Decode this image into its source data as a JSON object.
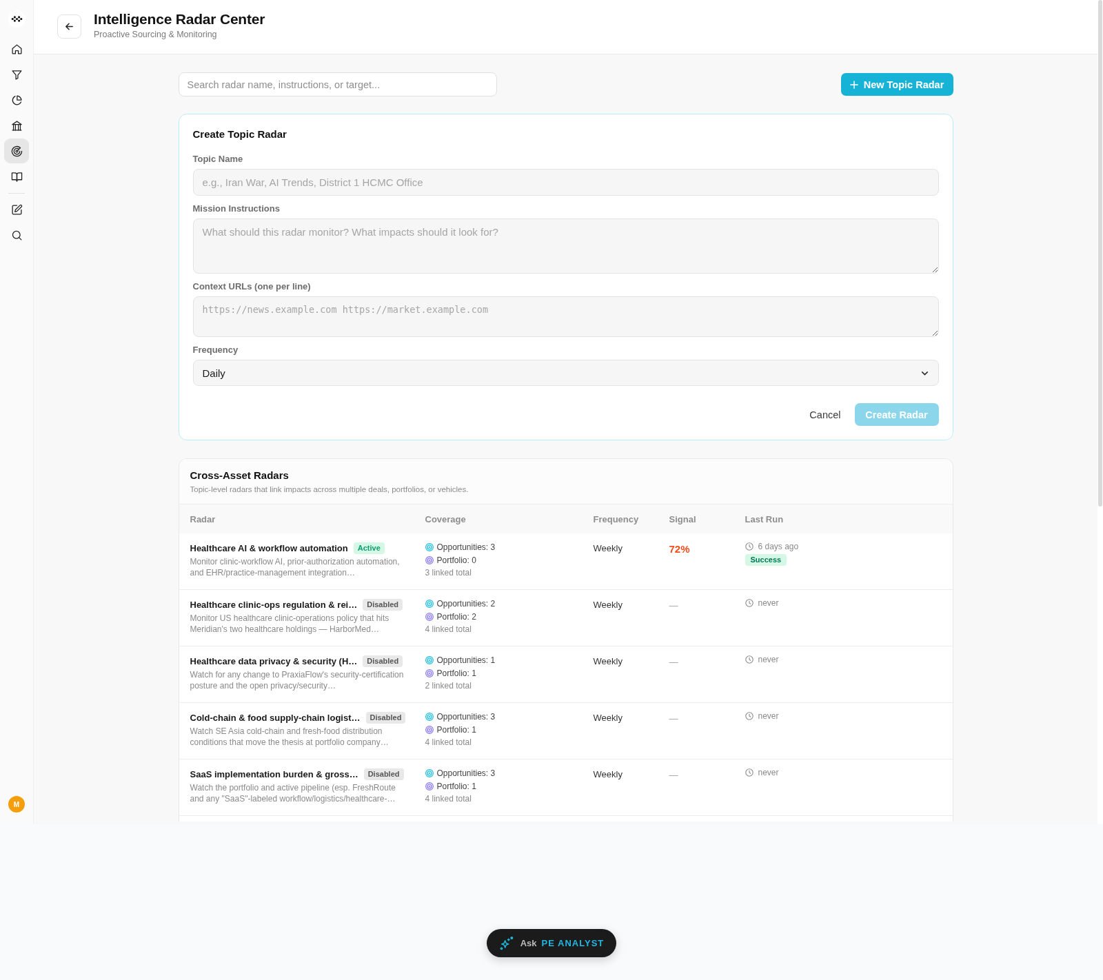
{
  "sidebar": {
    "primary": [
      {
        "selected": false
      },
      {
        "selected": false
      },
      {
        "selected": false
      },
      {
        "selected": false
      },
      {
        "selected": true
      },
      {
        "selected": false
      }
    ],
    "secondary": [
      {
        "selected": false
      },
      {
        "selected": false
      }
    ],
    "avatar": "M"
  },
  "header": {
    "title": "Intelligence Radar Center",
    "subtitle": "Proactive Sourcing & Monitoring"
  },
  "toolbar": {
    "search": {
      "placeholder": "Search radar name, instructions, or target..."
    },
    "new_button": "New Topic Radar"
  },
  "create_form": {
    "title": "Create Topic Radar",
    "fields": [
      {
        "kind": "text",
        "label": "Topic Name",
        "placeholder": "e.g., Iran War, AI Trends, District 1 HCMC Office"
      },
      {
        "kind": "textarea",
        "label": "Mission Instructions",
        "placeholder": "What should this radar monitor? What impacts should it look for?"
      },
      {
        "kind": "code",
        "label": "Context URLs (one per line)",
        "placeholder": "https://news.example.com https://market.example.com"
      },
      {
        "kind": "select",
        "label": "Frequency",
        "value": "Daily"
      }
    ],
    "cancel": "Cancel",
    "submit": {
      "label": "Create Radar",
      "disabled": true
    }
  },
  "table": {
    "title": "Cross-Asset Radars",
    "subtitle": "Topic-level radars that link impacts across multiple deals, portfolios, or vehicles.",
    "columns": [
      "Radar",
      "Coverage",
      "Frequency",
      "Signal",
      "Last Run"
    ],
    "rows": [
      {
        "name": "Healthcare AI & workflow automation",
        "status": "Active",
        "active": true,
        "description": "Monitor clinic-workflow AI, prior-authorization automation, and EHR/practice-management integration…",
        "coverage": {
          "opportunities": "Opportunities: 3",
          "portfolio": "Portfolio: 0",
          "total": "3 linked total"
        },
        "frequency": "Weekly",
        "signal": {
          "text": "72%",
          "kind": "score"
        },
        "last_run": "6 days ago",
        "result": {
          "label": "Success",
          "kind": "success"
        }
      },
      {
        "name": "Healthcare clinic-ops regulation & rei…",
        "status": "Disabled",
        "active": false,
        "description": "Monitor US healthcare clinic-operations policy that hits Meridian's two healthcare holdings — HarborMed…",
        "coverage": {
          "opportunities": "Opportunities: 2",
          "portfolio": "Portfolio: 2",
          "total": "4 linked total"
        },
        "frequency": "Weekly",
        "signal": {
          "text": "—",
          "kind": "none"
        },
        "last_run": "never"
      },
      {
        "name": "Healthcare data privacy & security (H…",
        "status": "Disabled",
        "active": false,
        "description": "Watch for any change to PraxiaFlow's security-certification posture and the open privacy/security…",
        "coverage": {
          "opportunities": "Opportunities: 1",
          "portfolio": "Portfolio: 1",
          "total": "2 linked total"
        },
        "frequency": "Weekly",
        "signal": {
          "text": "—",
          "kind": "none"
        },
        "last_run": "never"
      },
      {
        "name": "Cold-chain & food supply-chain logist…",
        "status": "Disabled",
        "active": false,
        "description": "Watch SE Asia cold-chain and fresh-food distribution conditions that move the thesis at portfolio company…",
        "coverage": {
          "opportunities": "Opportunities: 3",
          "portfolio": "Portfolio: 1",
          "total": "4 linked total"
        },
        "frequency": "Weekly",
        "signal": {
          "text": "—",
          "kind": "none"
        },
        "last_run": "never"
      },
      {
        "name": "SaaS implementation burden & gross…",
        "status": "Disabled",
        "active": false,
        "description": "Watch the portfolio and active pipeline (esp. FreshRoute and any \"SaaS\"-labeled workflow/logistics/healthcare-…",
        "coverage": {
          "opportunities": "Opportunities: 3",
          "portfolio": "Portfolio: 1",
          "total": "4 linked total"
        },
        "frequency": "Weekly",
        "signal": {
          "text": "—",
          "kind": "none"
        },
        "last_run": "never"
      }
    ]
  },
  "ask_button": {
    "prefix": "Ask",
    "label": "PE ANALYST"
  }
}
